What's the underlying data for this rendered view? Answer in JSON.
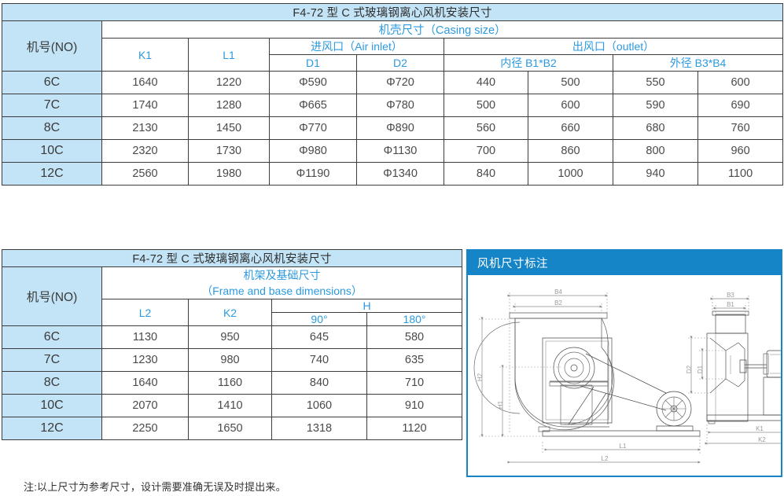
{
  "table1": {
    "title": "F4-72 型 C 式玻璃钢离心风机安装尺寸",
    "no_header": "机号(NO)",
    "group_casing": "机壳尺寸（Casing size）",
    "group_inlet": "进风口（Air inlet）",
    "group_outlet": "出风口（outlet）",
    "col_k1": "K1",
    "col_l1": "L1",
    "col_d1": "D1",
    "col_d2": "D2",
    "col_inner": "内径 B1*B2",
    "col_outer": "外径 B3*B4",
    "rows": [
      {
        "no": "6C",
        "k1": "1640",
        "l1": "1220",
        "d1": "Φ590",
        "d2": "Φ720",
        "b1": "440",
        "b2": "500",
        "b3": "550",
        "b4": "600"
      },
      {
        "no": "7C",
        "k1": "1740",
        "l1": "1280",
        "d1": "Φ665",
        "d2": "Φ780",
        "b1": "500",
        "b2": "600",
        "b3": "590",
        "b4": "690"
      },
      {
        "no": "8C",
        "k1": "2130",
        "l1": "1450",
        "d1": "Φ770",
        "d2": "Φ890",
        "b1": "560",
        "b2": "660",
        "b3": "680",
        "b4": "760"
      },
      {
        "no": "10C",
        "k1": "2320",
        "l1": "1730",
        "d1": "Φ980",
        "d2": "Φ1130",
        "b1": "700",
        "b2": "860",
        "b3": "800",
        "b4": "960"
      },
      {
        "no": "12C",
        "k1": "2560",
        "l1": "1980",
        "d1": "Φ1190",
        "d2": "Φ1340",
        "b1": "840",
        "b2": "1000",
        "b3": "940",
        "b4": "1100"
      }
    ]
  },
  "table2": {
    "title": "F4-72 型 C 式玻璃钢离心风机安装尺寸",
    "no_header": "机号(NO)",
    "group_frame_cn": "机架及基础尺寸",
    "group_frame_en": "（Frame and base dimensions）",
    "col_l2": "L2",
    "col_k2": "K2",
    "col_h": "H",
    "col_h90": "90°",
    "col_h180": "180°",
    "rows": [
      {
        "no": "6C",
        "l2": "1130",
        "k2": "950",
        "h90": "645",
        "h180": "580"
      },
      {
        "no": "7C",
        "l2": "1230",
        "k2": "980",
        "h90": "740",
        "h180": "635"
      },
      {
        "no": "8C",
        "l2": "1640",
        "k2": "1160",
        "h90": "840",
        "h180": "710"
      },
      {
        "no": "10C",
        "l2": "2070",
        "k2": "1410",
        "h90": "1060",
        "h180": "910"
      },
      {
        "no": "12C",
        "l2": "2250",
        "k2": "1650",
        "h90": "1318",
        "h180": "1120"
      }
    ]
  },
  "panel": {
    "title": "风机尺寸标注",
    "side_view_labels": {
      "b4": "B4",
      "b2": "B2",
      "h2": "H2",
      "h1": "H1",
      "l1": "L1",
      "l2": "L2"
    },
    "front_view_labels": {
      "b3": "B3",
      "b1": "B1",
      "d2": "D2",
      "d1": "D1",
      "k1": "K1",
      "k2": "K2"
    }
  },
  "footer": {
    "note": "注:以上尺寸为参考尺寸，设计需要准确无误及时提出来。"
  },
  "colors": {
    "header_blue_text": "#2b9ae0",
    "light_blue_fill": "#c3e4f6",
    "panel_blue": "#1585c8",
    "border_gray": "#3c3c3c",
    "value_text": "#4a4a4a"
  }
}
